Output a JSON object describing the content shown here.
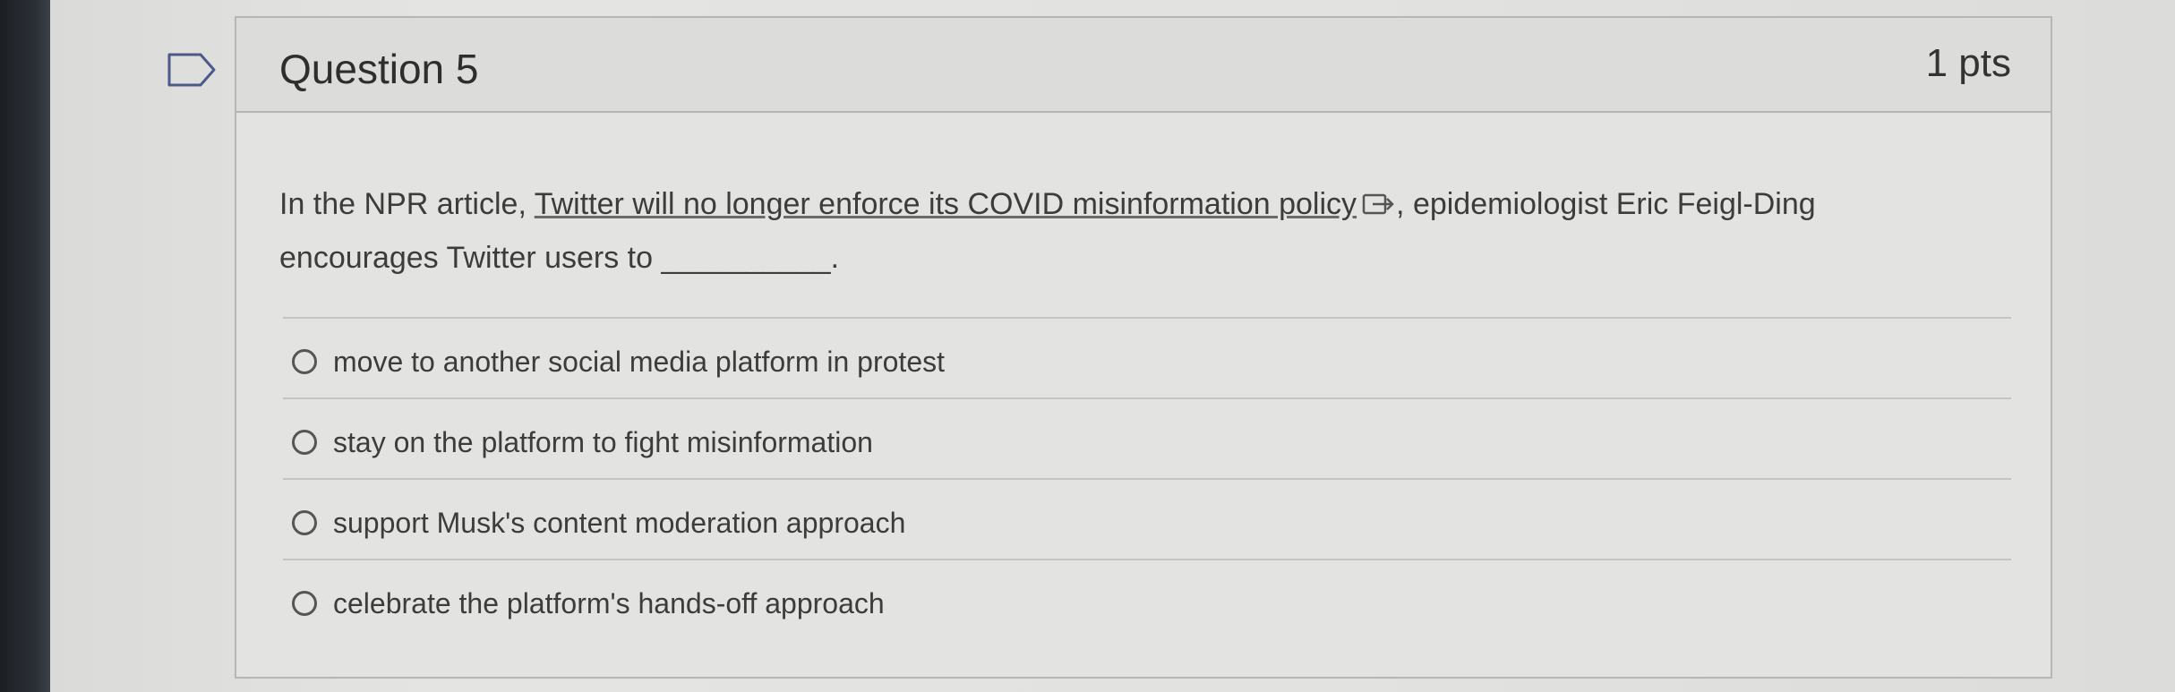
{
  "question": {
    "title": "Question 5",
    "points": "1 pts",
    "text_before": "In the NPR article, ",
    "link_text": "Twitter will no longer enforce its COVID misinformation policy",
    "text_after_link": ", epidemiologist Eric Feigl-Ding encourages Twitter users to __________."
  },
  "options": [
    {
      "label": "move to another social media platform in protest"
    },
    {
      "label": "stay on the platform to fight misinformation"
    },
    {
      "label": "support Musk's content moderation approach"
    },
    {
      "label": "celebrate the platform's hands-off approach"
    }
  ],
  "icons": {
    "flag": "bookmark-flag-icon",
    "external_link": "external-link-icon",
    "radio": "radio-button-icon"
  }
}
